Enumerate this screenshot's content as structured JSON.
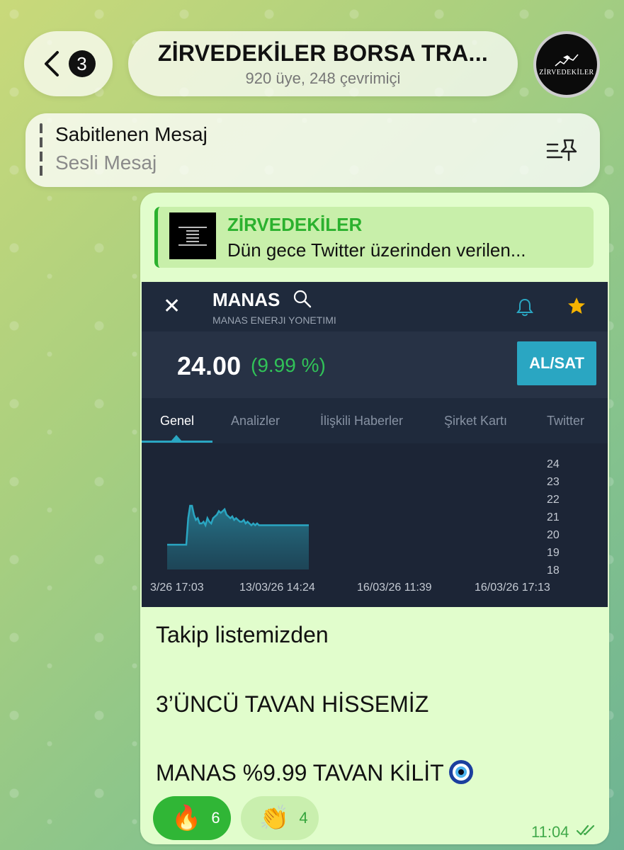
{
  "header": {
    "back_count": "3",
    "title": "ZİRVEDEKİLER BORSA TRA...",
    "subtitle": "920 üye, 248 çevrimiçi",
    "avatar_text": "ZİRVEDEKİLER"
  },
  "pinned": {
    "title": "Sabitlenen Mesaj",
    "subtitle": "Sesli Mesaj"
  },
  "forward": {
    "name": "ZİRVEDEKİLER",
    "text": "Dün gece Twitter üzerinden verilen..."
  },
  "stock": {
    "symbol": "MANAS",
    "company": "MANAS ENERJI YONETIMI",
    "price": "24.00",
    "change": "(9.99 %)",
    "trade_button": "AL/SAT",
    "tabs": [
      "Genel",
      "Analizler",
      "İlişkili Haberler",
      "Şirket Kartı",
      "Twitter"
    ],
    "active_tab": "Genel"
  },
  "chart_data": {
    "type": "area",
    "y_ticks": [
      "24",
      "23",
      "22",
      "21",
      "20",
      "19",
      "18"
    ],
    "ylim": [
      18,
      24
    ],
    "x_ticks": [
      "3/26 17:03",
      "13/03/26 14:24",
      "16/03/26 11:39",
      "16/03/26 17:13"
    ],
    "series": [
      {
        "values": [
          19.4,
          19.4,
          19.4,
          19.4,
          19.4,
          19.4,
          19.4,
          19.4,
          19.4,
          19.4,
          19.4,
          20.9,
          21.6,
          21.6,
          21.1,
          20.8,
          20.9,
          20.6,
          20.6,
          20.7,
          20.5,
          20.9,
          20.7,
          20.6,
          20.9,
          21.0,
          21.1,
          21.3,
          21.2,
          21.3,
          21.4,
          21.1,
          21.0,
          20.9,
          21.0,
          20.8,
          20.9,
          20.8,
          20.7,
          20.7,
          20.8,
          20.6,
          20.7,
          20.6,
          20.5,
          20.6,
          20.5,
          20.6,
          20.5,
          20.5,
          20.5,
          20.5,
          20.5,
          20.5,
          20.5,
          20.5,
          20.5,
          20.5,
          20.5,
          20.5,
          20.5,
          20.5,
          20.5,
          20.5,
          20.5,
          20.5,
          20.5,
          20.5,
          20.5,
          20.5,
          20.5,
          20.5,
          20.5,
          20.5,
          20.5
        ]
      }
    ],
    "colors": {
      "line": "#2aa6c2",
      "background": "#1c2536"
    }
  },
  "message": {
    "line1": "Takip listemizden",
    "line2": "3’ÜNCÜ TAVAN HİSSEMİZ",
    "line3": "MANAS %9.99 TAVAN KİLİT",
    "line3_emoji": "nazar-amulet-icon"
  },
  "reactions": [
    {
      "emoji": "🔥",
      "count": "6"
    },
    {
      "emoji": "👏",
      "count": "4"
    }
  ],
  "time": "11:04",
  "colors": {
    "bubble": "#e1fdcc",
    "accent_green": "#2bb12e",
    "trade_button": "#2aa6c2",
    "positive": "#31c258"
  }
}
